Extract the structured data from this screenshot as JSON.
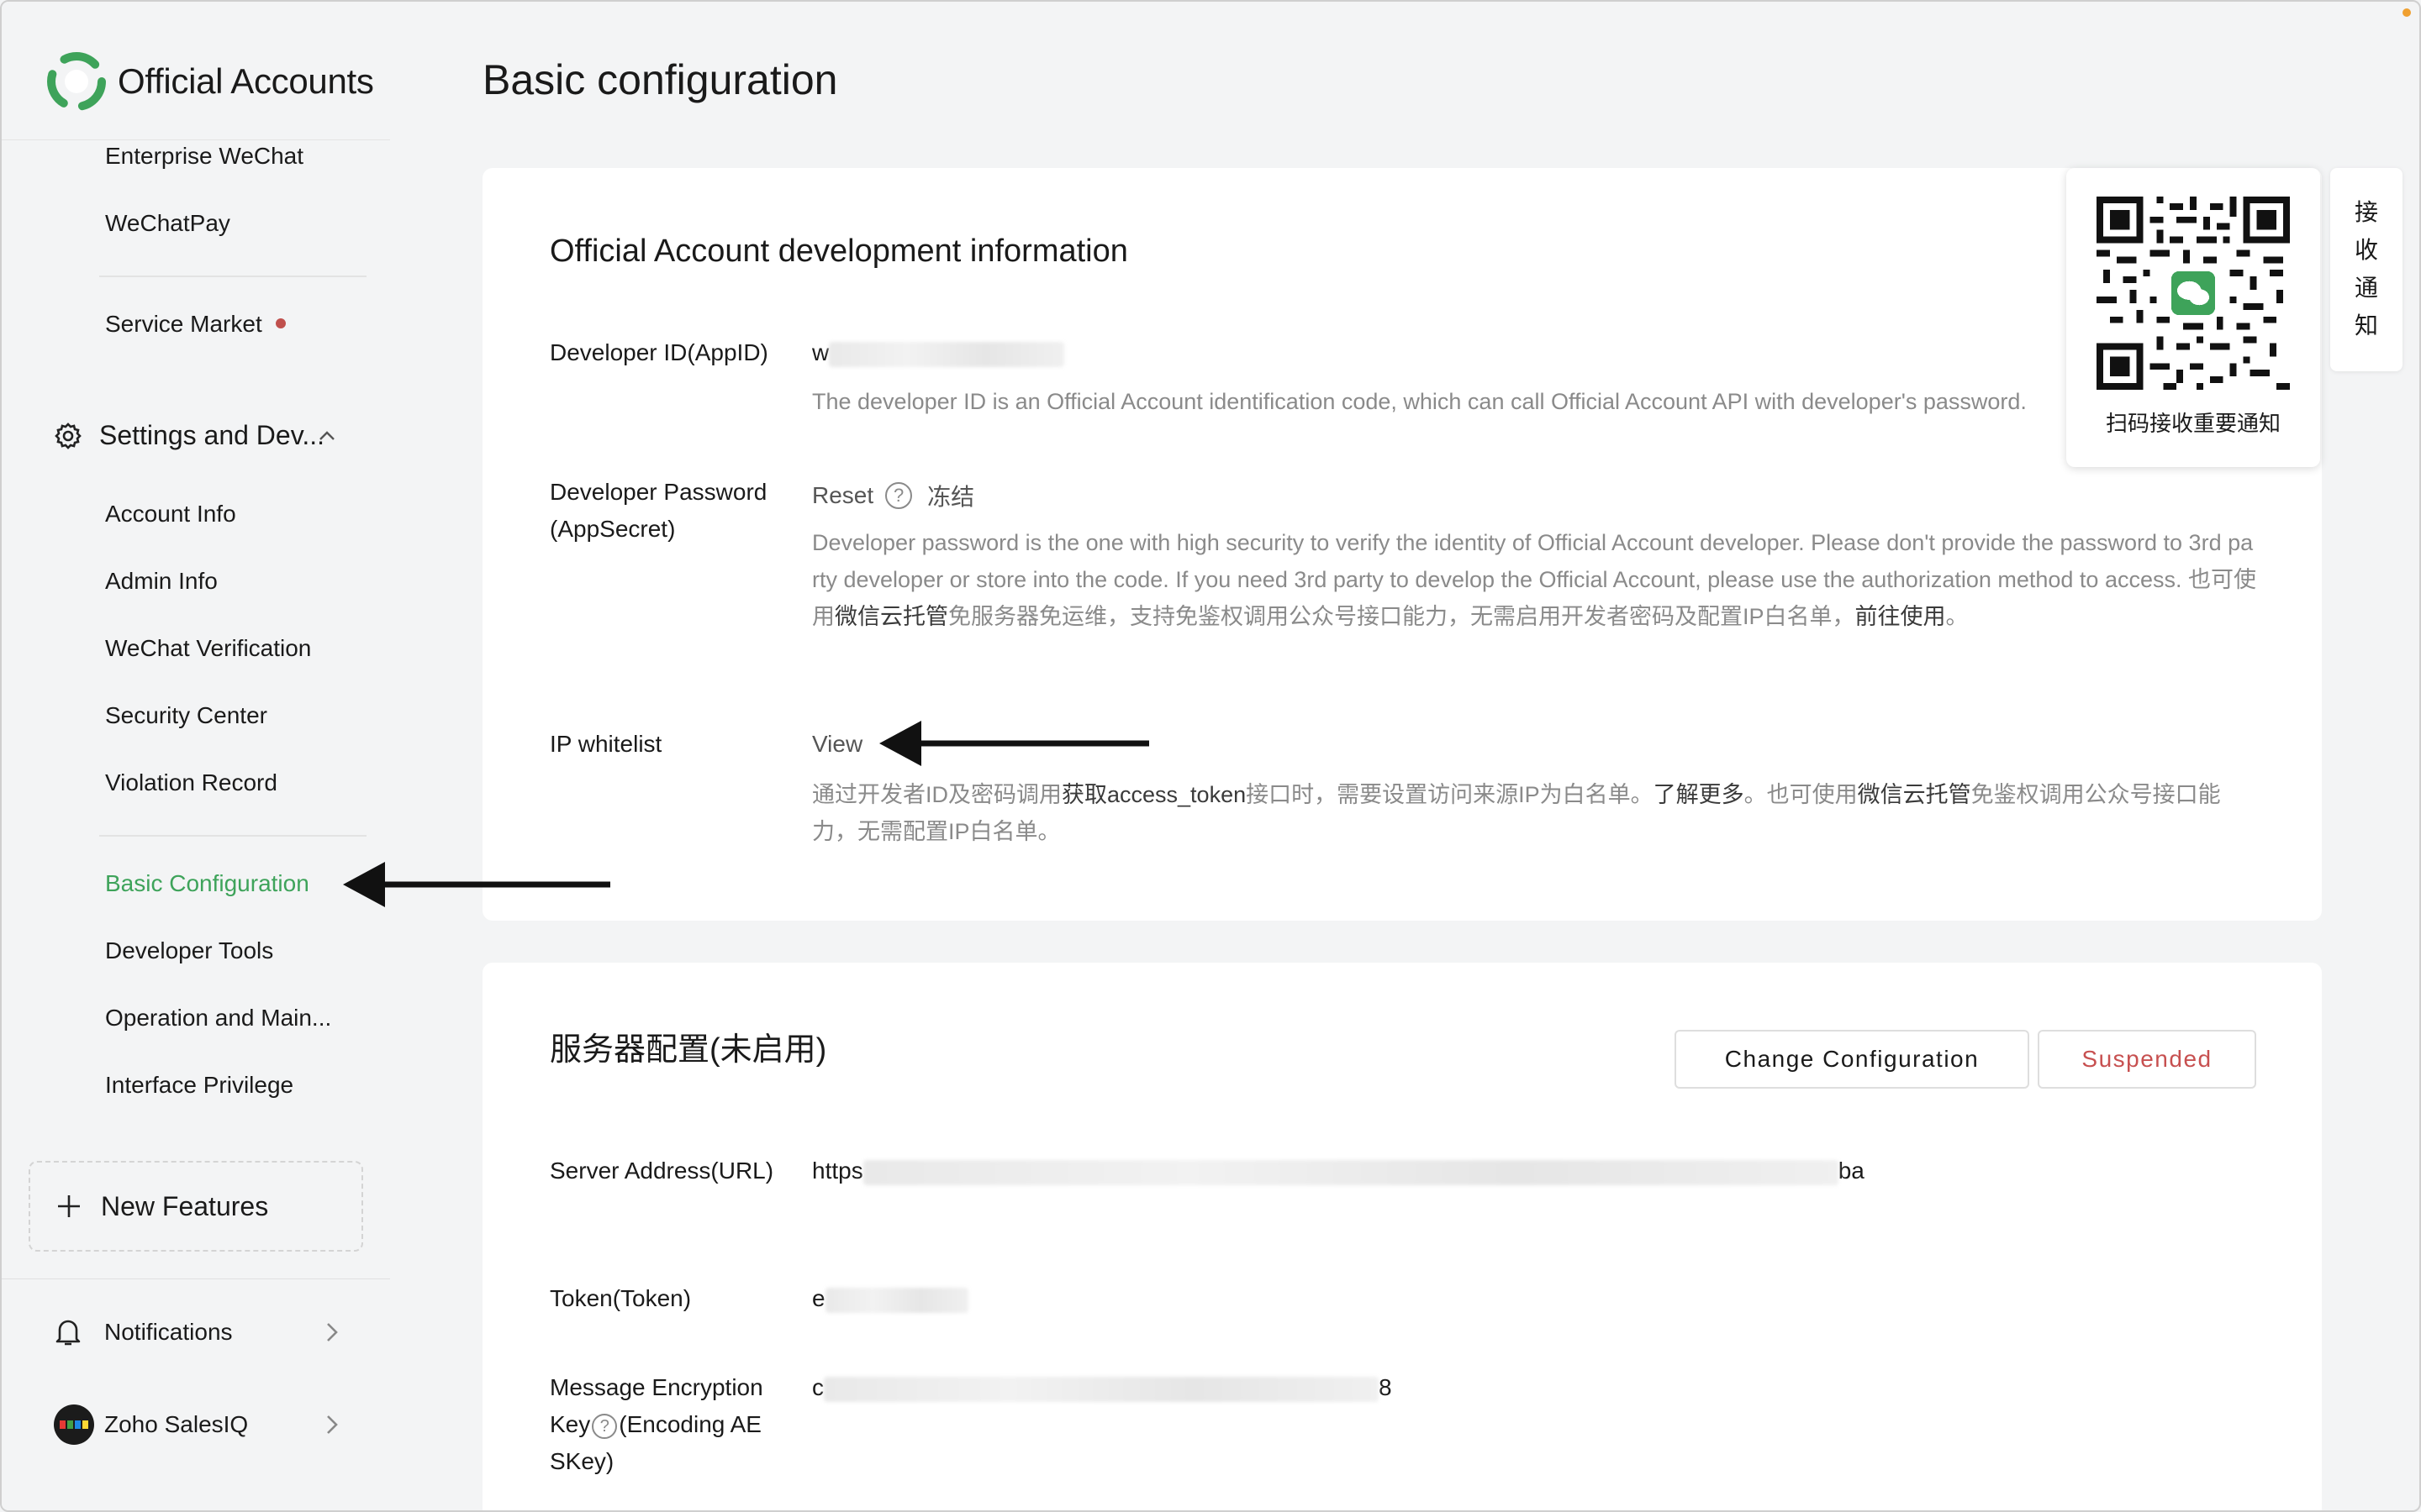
{
  "sidebar": {
    "logo_title": "Official Accounts",
    "top_items": [
      "Enterprise WeChat",
      "WeChatPay"
    ],
    "service_market": "Service Market",
    "settings_section": "Settings and Dev...",
    "settings_items": [
      "Account Info",
      "Admin Info",
      "WeChat Verification",
      "Security Center",
      "Violation Record",
      "Basic Configuration",
      "Developer Tools",
      "Operation and Main...",
      "Interface Privilege"
    ],
    "new_features": "New Features",
    "notifications": "Notifications",
    "account_name": "Zoho SalesIQ",
    "colors": {
      "active": "#3ea35a",
      "badge": "#c0504d"
    }
  },
  "main": {
    "page_title": "Basic configuration",
    "dev_info": {
      "title": "Official Account development information",
      "developer_id_label": "Developer ID(AppID)",
      "developer_id_prefix": "w",
      "developer_id_desc": "The developer ID is an Official Account identification code, which can call Official Account API with developer's password.",
      "password_label": "Developer Password(AppSecret)",
      "reset_label": "Reset",
      "freeze_label": "冻结",
      "password_desc_1": "Developer password is the one with high security to verify the identity of Official Account developer. Please don't provide the password to 3rd party developer or store into the code. If you need 3rd party to develop the Official Account, please use the authorization method to access. 也可使用",
      "password_desc_link_1": "微信云托管",
      "password_desc_2": "免服务器免运维，支持免鉴权调用公众号接口能力，无需启用开发者密码及配置IP白名单，",
      "password_desc_link_2": "前往使用",
      "password_desc_3": "。",
      "ip_label": "IP whitelist",
      "ip_view": "View",
      "ip_desc_1": "通过开发者ID及密码调用",
      "ip_desc_link_1": "获取access_token",
      "ip_desc_2": "接口时，需要设置访问来源IP为白名单。",
      "ip_desc_link_2": "了解更多",
      "ip_desc_3": "。也可使用",
      "ip_desc_link_3": "微信云托管",
      "ip_desc_4": "免鉴权调用公众号接口能力，无需配置IP白名单。"
    },
    "server_config": {
      "title": "服务器配置(未启用)",
      "change_button": "Change Configuration",
      "suspended_button": "Suspended",
      "url_label": "Server Address(URL)",
      "url_prefix": "https",
      "url_suffix": "ba",
      "token_label": "Token(Token)",
      "token_prefix": "e",
      "aes_label_1": "Message Encryption Key",
      "aes_label_2": "(Encoding AESKey)",
      "aes_prefix": "c",
      "aes_suffix": "8",
      "colors": {
        "suspended": "#c75050"
      }
    }
  },
  "qr_popover": {
    "caption": "扫码接收重要通知"
  },
  "notify_tab": {
    "chars": [
      "接",
      "收",
      "通",
      "知"
    ]
  }
}
